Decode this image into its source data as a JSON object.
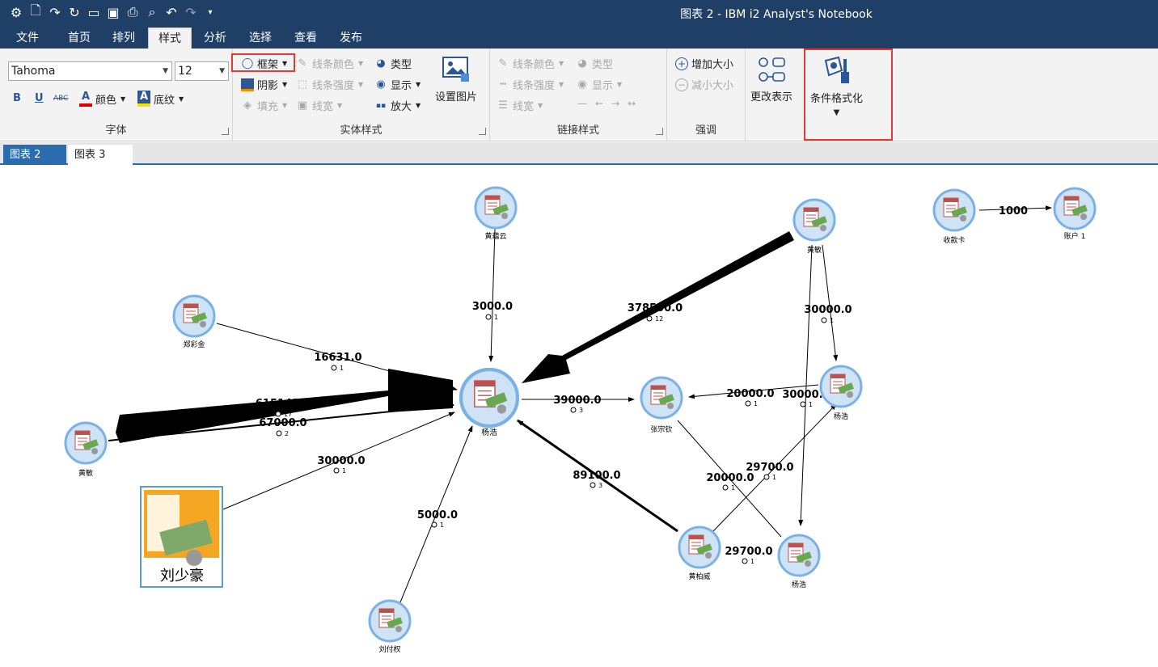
{
  "window": {
    "title": "图表 2 - IBM i2 Analyst's Notebook"
  },
  "quick_access": [
    "settings-icon",
    "new-icon",
    "redo-arc-icon",
    "redo-hand-icon",
    "open-folder-icon",
    "save-icon",
    "print-icon",
    "search-icon",
    "undo-icon",
    "redo-icon",
    "customize-icon"
  ],
  "menu_tabs": [
    "文件",
    "首页",
    "排列",
    "样式",
    "分析",
    "选择",
    "查看",
    "发布"
  ],
  "active_tab": "样式",
  "ribbon": {
    "font": {
      "font_name": "Tahoma",
      "font_size": "12",
      "bold": "B",
      "underline": "U",
      "strike": "ABC",
      "color_label": "颜色",
      "shade_label": "底纹",
      "group_label": "字体"
    },
    "entity_style": {
      "frame": "框架",
      "shadow": "阴影",
      "fill": "填充",
      "line_color": "线条颜色",
      "line_strength": "线条强度",
      "line_width": "线宽",
      "type": "类型",
      "display": "显示",
      "enlarge": "放大",
      "group_label": "实体样式"
    },
    "set_image": "设置图片",
    "link_style": {
      "line_color": "线条颜色",
      "line_strength": "线条强度",
      "line_width": "线宽",
      "type": "类型",
      "display": "显示",
      "group_label": "链接样式"
    },
    "emphasis": {
      "increase": "增加大小",
      "decrease": "减小大小",
      "group_label": "强调"
    },
    "change_repr": "更改表示",
    "conditional_format": "条件格式化"
  },
  "document_tabs": [
    {
      "label": "图表 2",
      "active": true
    },
    {
      "label": "图表 3",
      "active": false
    }
  ],
  "graph": {
    "nodes": [
      {
        "id": "n_cyy",
        "label": "黄蕴云"
      },
      {
        "id": "n_zcj",
        "label": "郑彩金"
      },
      {
        "id": "n_center",
        "label": "杨浩"
      },
      {
        "id": "n_hm_left",
        "label": "黄敏"
      },
      {
        "id": "n_lsh",
        "label": "刘少豪"
      },
      {
        "id": "n_lfq",
        "label": "刘付权"
      },
      {
        "id": "n_zzq",
        "label": "张宗钦"
      },
      {
        "id": "n_hm_top",
        "label": "黄敏"
      },
      {
        "id": "n_yh_right",
        "label": "杨浩"
      },
      {
        "id": "n_hbw",
        "label": "黄柏威"
      },
      {
        "id": "n_yh_bottom",
        "label": "杨浩"
      },
      {
        "id": "n_skk",
        "label": "收款卡"
      },
      {
        "id": "n_acc",
        "label": "账户 1"
      }
    ],
    "links": [
      {
        "amount": "3000.0",
        "count": "1"
      },
      {
        "amount": "16631.0",
        "count": "1"
      },
      {
        "amount": "615142.0",
        "count": "17"
      },
      {
        "amount": "67000.0",
        "count": "2"
      },
      {
        "amount": "30000.0",
        "count": "1"
      },
      {
        "amount": "5000.0",
        "count": "1"
      },
      {
        "amount": "378500.0",
        "count": "12"
      },
      {
        "amount": "39000.0",
        "count": "3"
      },
      {
        "amount": "89100.0",
        "count": "3"
      },
      {
        "amount": "20000.0",
        "count": "1"
      },
      {
        "amount": "30000.0",
        "count": "1"
      },
      {
        "amount": "30000.0",
        "count": "1"
      },
      {
        "amount": "20000.0",
        "count": "1"
      },
      {
        "amount": "29700.0",
        "count": "1"
      },
      {
        "amount": "29700.0",
        "count": "1"
      },
      {
        "amount": "1000",
        "count": ""
      }
    ]
  }
}
